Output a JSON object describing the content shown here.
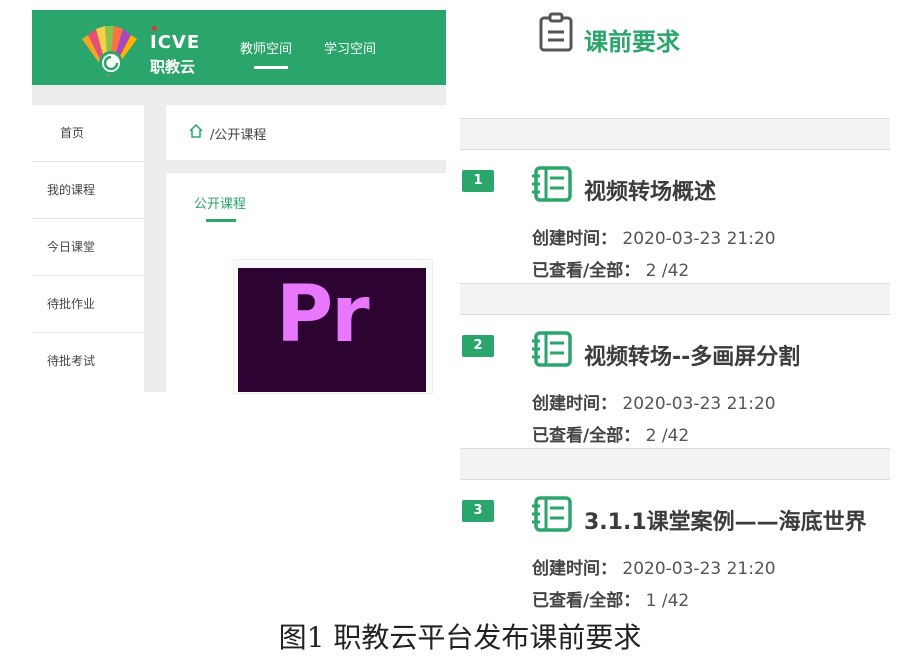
{
  "platform": {
    "brand_en": "ICVE",
    "brand_cn": "职教云",
    "nav": [
      "教师空间",
      "学习空间"
    ],
    "sidebar": [
      "首页",
      "我的课程",
      "今日课堂",
      "待批作业",
      "待批考试"
    ],
    "breadcrumb": "/公开课程",
    "tab": "公开课程",
    "course_tile_text": "Pr"
  },
  "requirements": {
    "title": "课前要求",
    "created_label": "创建时间：",
    "viewed_label": "已查看/全部：",
    "items": [
      {
        "index": "1",
        "title": "视频转场概述",
        "created": "2020-03-23 21:20",
        "viewed": "2 /42"
      },
      {
        "index": "2",
        "title": "视频转场--多画屏分割",
        "created": "2020-03-23 21:20",
        "viewed": "2 /42"
      },
      {
        "index": "3",
        "title": "3.1.1课堂案例——海底世界",
        "created": "2020-03-23 21:20",
        "viewed": "1 /42"
      }
    ]
  },
  "caption": "图1  职教云平台发布课前要求",
  "colors": {
    "accent": "#2aa56b",
    "pr_bg": "#2d0431",
    "pr_text": "#ea77ff"
  }
}
